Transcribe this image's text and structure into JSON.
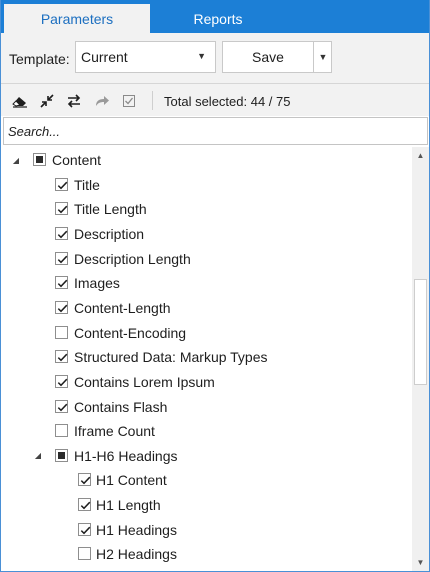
{
  "tabs": [
    {
      "label": "Parameters",
      "active": true
    },
    {
      "label": "Reports",
      "active": false
    }
  ],
  "template": {
    "label": "Template:",
    "selected": "Current",
    "save_label": "Save"
  },
  "toolbar": {
    "icons": [
      "eraser-icon",
      "collapse-icon",
      "swap-icon",
      "redo-icon",
      "checkbox-icon"
    ],
    "total_text": "Total selected: 44 / 75"
  },
  "search": {
    "placeholder": "Search..."
  },
  "tree": {
    "items": [
      {
        "label": "Content",
        "level": 0,
        "state": "partial",
        "expander": true
      },
      {
        "label": "Title",
        "level": 1,
        "state": "checked"
      },
      {
        "label": "Title Length",
        "level": 1,
        "state": "checked"
      },
      {
        "label": "Description",
        "level": 1,
        "state": "checked"
      },
      {
        "label": "Description Length",
        "level": 1,
        "state": "checked"
      },
      {
        "label": "Images",
        "level": 1,
        "state": "checked"
      },
      {
        "label": "Content-Length",
        "level": 1,
        "state": "checked"
      },
      {
        "label": "Content-Encoding",
        "level": 1,
        "state": "unchecked"
      },
      {
        "label": "Structured Data: Markup Types",
        "level": 1,
        "state": "checked"
      },
      {
        "label": "Contains Lorem Ipsum",
        "level": 1,
        "state": "checked"
      },
      {
        "label": "Contains Flash",
        "level": 1,
        "state": "checked"
      },
      {
        "label": "Iframe Count",
        "level": 1,
        "state": "unchecked"
      },
      {
        "label": "H1-H6 Headings",
        "level": 1,
        "state": "partial",
        "expander": true
      },
      {
        "label": "H1 Content",
        "level": 2,
        "state": "checked"
      },
      {
        "label": "H1 Length",
        "level": 2,
        "state": "checked"
      },
      {
        "label": "H1 Headings",
        "level": 2,
        "state": "checked"
      },
      {
        "label": "H2 Headings",
        "level": 2,
        "state": "unchecked"
      }
    ]
  },
  "colors": {
    "accent": "#1c7fd6",
    "panel": "#f2f2f2"
  }
}
